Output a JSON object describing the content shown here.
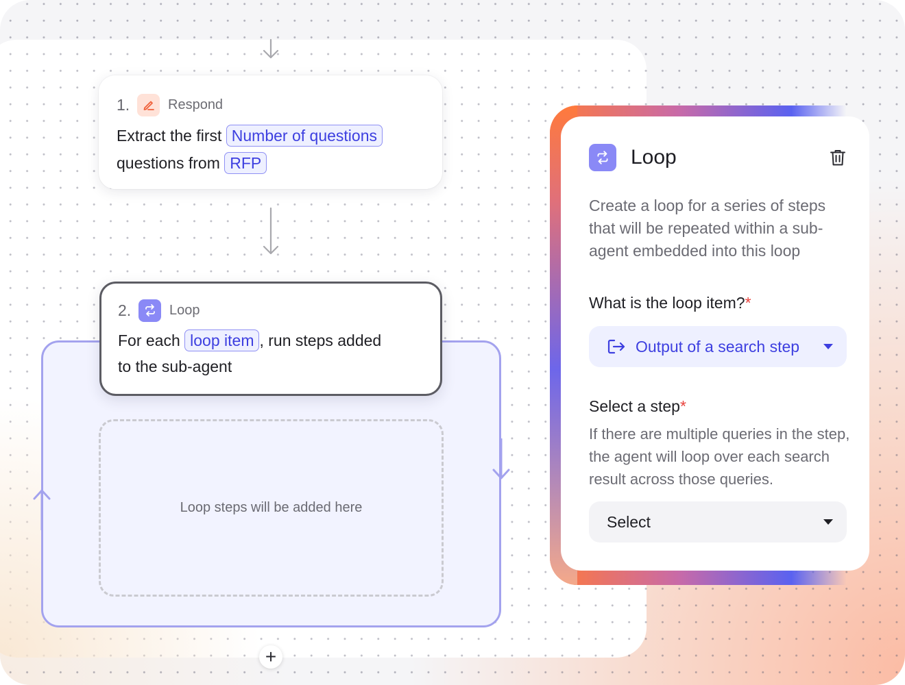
{
  "flow": {
    "steps": [
      {
        "number": "1.",
        "type": "Respond",
        "text_1": "Extract the first",
        "chip_1": "Number of questions",
        "text_2": "questions from",
        "chip_2": "RFP"
      },
      {
        "number": "2.",
        "type": "Loop",
        "text_1": "For each",
        "chip_1": "loop item",
        "text_2": ", run steps added",
        "text_3": "to the sub-agent"
      }
    ],
    "dropzone_label": "Loop steps will be added here",
    "add_label": "+"
  },
  "panel": {
    "title": "Loop",
    "description": "Create a loop for a series of steps that will be repeated within a sub-agent embedded into this loop",
    "loop_item": {
      "label": "What is the loop item?",
      "required_mark": "*",
      "value": "Output of a search step"
    },
    "select_step": {
      "label": "Select a step",
      "required_mark": "*",
      "help": "If there are multiple queries in the step, the agent will loop over each search result across those queries.",
      "value": "Select"
    }
  },
  "icons": {
    "respond": "pencil-icon",
    "loop": "loop-arrows-icon",
    "delete": "trash-icon",
    "output": "output-arrow-icon"
  },
  "colors": {
    "accent": "#3d3fe0",
    "loop_icon_bg": "#8a89f6",
    "respond_icon_bg": "#ffe2d8",
    "respond_icon": "#f0603a",
    "loop_border": "#a3a2ee",
    "required": "#e8413c"
  }
}
